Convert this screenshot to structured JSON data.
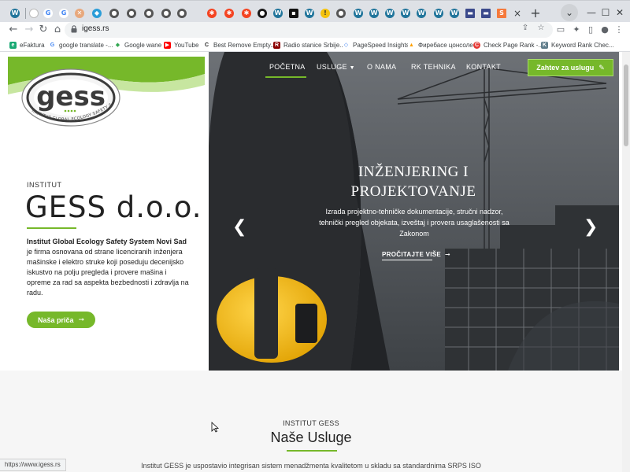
{
  "browser": {
    "url": "igess.rs",
    "tab_close": "×",
    "new_tab": "+",
    "window_minimize": "—",
    "window_maximize": "☐",
    "window_close": "✕",
    "tab_menu": "⌄"
  },
  "bookmarks": [
    {
      "label": "eFaktura",
      "color": "#19a974",
      "glyph": "e"
    },
    {
      "label": "google translate -...",
      "color": "#4285f4",
      "glyph": "G"
    },
    {
      "label": "Google wane",
      "color": "#34a853",
      "glyph": "◆"
    },
    {
      "label": "YouTube",
      "color": "#ff0000",
      "glyph": "▶"
    },
    {
      "label": "Best Remove Empty...",
      "color": "#222222",
      "glyph": "C"
    },
    {
      "label": "Radio stanice Srbije...",
      "color": "#8b0000",
      "glyph": "R"
    },
    {
      "label": "PageSpeed Insights",
      "color": "#4285f4",
      "glyph": "◇"
    },
    {
      "label": "Фиребасе цонсоле",
      "color": "#ffa000",
      "glyph": "▲"
    },
    {
      "label": "Check Page Rank -...",
      "color": "#e53935",
      "glyph": "C"
    },
    {
      "label": "Keyword Rank Chec...",
      "color": "#607d8b",
      "glyph": "K"
    }
  ],
  "site": {
    "logo_text": "gess",
    "logo_subtext": "INSTITUT GLOBAL ECOLOGY SAFETY SYSTEM",
    "institut_label": "INSTITUT",
    "company_name": "GESS d.o.o.",
    "description_bold": "Institut Global Ecology Safety System Novi Sad",
    "description_rest": " je firma osnovana od strane licenciranih inženjera mašinske i elektro struke koji poseduju decenijsko iskustvo na polju pregleda i provere mašina i opreme za rad sa aspekta bezbednosti i zdravlja na radu.",
    "story_button": "Naša priča",
    "nav": [
      {
        "label": "POČETNA"
      },
      {
        "label": "USLUGE"
      },
      {
        "label": "O NAMA"
      },
      {
        "label": "RK TEHNIKA"
      },
      {
        "label": "KONTAKT"
      }
    ],
    "quote_button": "Zahtev za uslugu",
    "slide_title_line1": "INŽENJERING I",
    "slide_title_line2": "PROJEKTOVANJE",
    "slide_text": "Izrada projektno-tehničke dokumentacije, stručni nadzor, tehnički pregled objekata, izveštaj i provera usaglašenosti sa Zakonom",
    "read_more": "PROČITAJTE VIŠE",
    "services_label": "INSTITUT GESS",
    "services_title": "Naše Usluge",
    "services_text": "Institut GESS je uspostavio integrisan sistem menadžmenta kvalitetom u skladu sa standardnima SRPS ISO",
    "status_url": "https://www.igess.rs"
  },
  "colors": {
    "accent_green": "#76b82a",
    "hero_gray": "#5f6367"
  }
}
